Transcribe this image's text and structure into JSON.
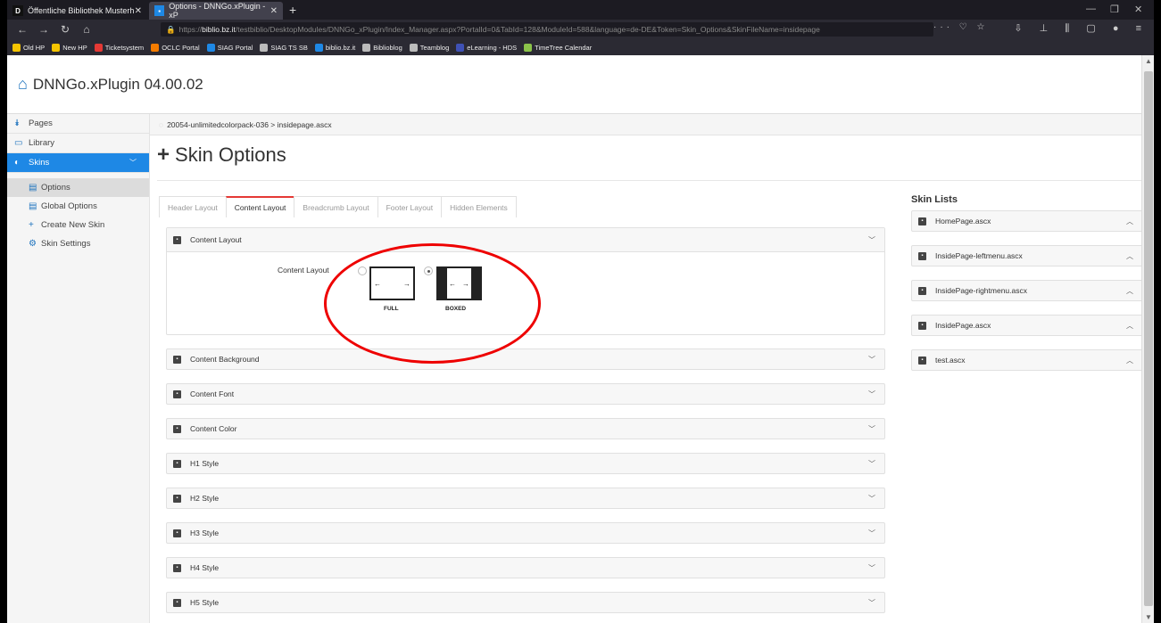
{
  "browser": {
    "tabs": [
      {
        "label": "Öffentliche Bibliothek Musterh",
        "favicon": "D"
      },
      {
        "label": "Options - DNNGo.xPlugin - xP",
        "favicon": "▪"
      }
    ],
    "url_prefix": "https://",
    "url_host": "biblio.bz.it",
    "url_path": "/testbiblio/DesktopModules/DNNGo_xPlugin/Index_Manager.aspx?PortalId=0&TabId=128&ModuleId=588&language=de-DE&Token=Skin_Options&SkinFileName=insidepage",
    "bookmarks": [
      {
        "label": "Old HP",
        "color": "#f5c400"
      },
      {
        "label": "New HP",
        "color": "#f5c400"
      },
      {
        "label": "Ticketsystem",
        "color": "#e53935"
      },
      {
        "label": "OCLC Portal",
        "color": "#f57c00"
      },
      {
        "label": "SIAG Portal",
        "color": "#1e88e5"
      },
      {
        "label": "SIAG TS SB",
        "color": "#bbbbbb"
      },
      {
        "label": "biblio.bz.it",
        "color": "#1e88e5"
      },
      {
        "label": "Biblioblog",
        "color": "#bbbbbb"
      },
      {
        "label": "Teamblog",
        "color": "#bbbbbb"
      },
      {
        "label": "eLearning - HDS",
        "color": "#3f51b5"
      },
      {
        "label": "TimeTree Calendar",
        "color": "#8bc34a"
      }
    ]
  },
  "app": {
    "title": "DNNGo.xPlugin 04.00.02"
  },
  "sidebar": {
    "items": [
      {
        "label": "Pages",
        "icon": "⯯"
      },
      {
        "label": "Library",
        "icon": "▭"
      },
      {
        "label": "Skins",
        "icon": "◐"
      }
    ],
    "sub_items": [
      {
        "label": "Options",
        "icon": "▤"
      },
      {
        "label": "Global Options",
        "icon": "▤"
      },
      {
        "label": "Create New Skin",
        "icon": "+"
      },
      {
        "label": "Skin Settings",
        "icon": "⚙"
      }
    ]
  },
  "breadcrumb": "20054-unlimitedcolorpack-036 > insidepage.ascx",
  "page_title": "Skin Options",
  "tabs": [
    "Header Layout",
    "Content Layout",
    "Breadcrumb Layout",
    "Footer Layout",
    "Hidden Elements"
  ],
  "content_layout": {
    "header": "Content Layout",
    "label": "Content Layout",
    "options": [
      "FULL",
      "BOXED"
    ],
    "selected": "BOXED"
  },
  "panels": [
    "Content Background",
    "Content Font",
    "Content Color",
    "H1 Style",
    "H2 Style",
    "H3 Style",
    "H4 Style",
    "H5 Style"
  ],
  "skin_lists": {
    "title": "Skin Lists",
    "items": [
      "HomePage.ascx",
      "InsidePage-leftmenu.ascx",
      "InsidePage-rightmenu.ascx",
      "InsidePage.ascx",
      "test.ascx"
    ]
  }
}
